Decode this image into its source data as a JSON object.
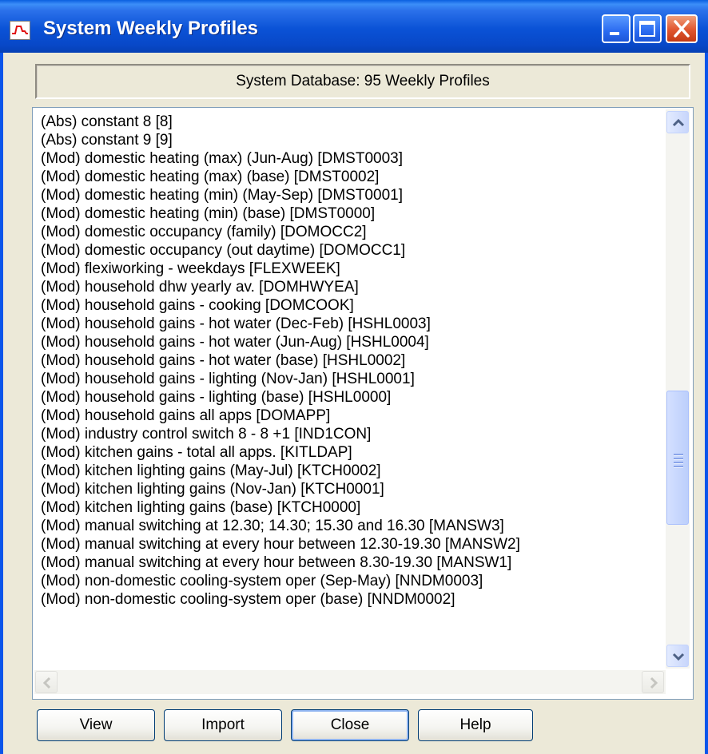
{
  "window": {
    "title": "System Weekly Profiles"
  },
  "header": {
    "text": "System Database: 95 Weekly Profiles"
  },
  "list": {
    "items": [
      "(Abs) constant 8 [8]",
      "(Abs) constant 9 [9]",
      "(Mod) domestic heating (max) (Jun-Aug) [DMST0003]",
      "(Mod) domestic heating (max) (base) [DMST0002]",
      "(Mod) domestic heating (min) (May-Sep) [DMST0001]",
      "(Mod) domestic heating (min) (base) [DMST0000]",
      "(Mod) domestic occupancy (family) [DOMOCC2]",
      "(Mod) domestic occupancy (out daytime) [DOMOCC1]",
      "(Mod) flexiworking - weekdays [FLEXWEEK]",
      "(Mod) household dhw yearly av. [DOMHWYEA]",
      "(Mod) household gains - cooking [DOMCOOK]",
      "(Mod) household gains - hot water (Dec-Feb) [HSHL0003]",
      "(Mod) household gains - hot water (Jun-Aug) [HSHL0004]",
      "(Mod) household gains - hot water (base) [HSHL0002]",
      "(Mod) household gains - lighting (Nov-Jan) [HSHL0001]",
      "(Mod) household gains - lighting (base) [HSHL0000]",
      "(Mod) household gains all apps [DOMAPP]",
      "(Mod) industry control switch 8 - 8 +1 [IND1CON]",
      "(Mod) kitchen gains - total all apps. [KITLDAP]",
      "(Mod) kitchen lighting gains (May-Jul) [KTCH0002]",
      "(Mod) kitchen lighting gains (Nov-Jan) [KTCH0001]",
      "(Mod) kitchen lighting gains (base) [KTCH0000]",
      "(Mod) manual switching at 12.30; 14.30; 15.30 and 16.30 [MANSW3]",
      "(Mod) manual switching at every hour between 12.30-19.30 [MANSW2]",
      "(Mod) manual switching at every hour between 8.30-19.30 [MANSW1]",
      "(Mod) non-domestic cooling-system oper (Sep-May) [NNDM0003]",
      "(Mod) non-domestic cooling-system oper (base) [NNDM0002]"
    ],
    "scroll_position_fraction": 0.55
  },
  "buttons": {
    "view": "View",
    "import": "Import",
    "close": "Close",
    "help": "Help"
  },
  "icons": {
    "app": "chart-profile-icon",
    "minimize": "minimize-icon",
    "maximize": "maximize-icon",
    "close": "close-icon"
  },
  "colors": {
    "titlebar": "#0a52d6",
    "window_bg": "#ece9d8",
    "close_button": "#e0552e",
    "scrollbar_thumb": "#c8d6fb"
  }
}
